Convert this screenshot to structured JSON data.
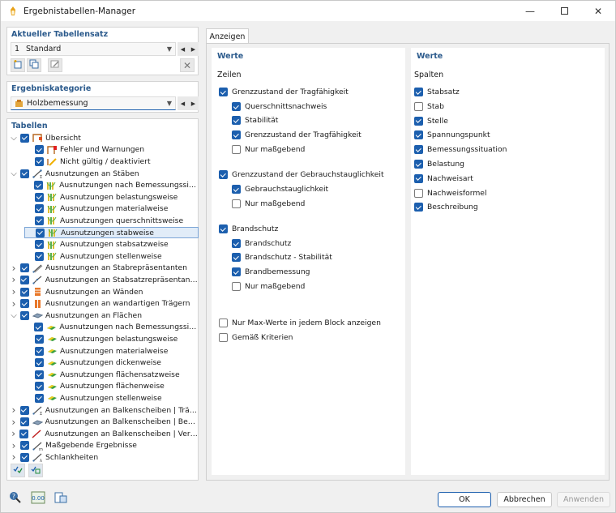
{
  "window": {
    "title": "Ergebnistabellen-Manager"
  },
  "tableset": {
    "header": "Aktueller Tabellensatz",
    "number": "1",
    "name": "Standard"
  },
  "category": {
    "header": "Ergebniskategorie",
    "value": "Holzbemessung"
  },
  "tables": {
    "header": "Tabellen",
    "items": [
      {
        "label": "Übersicht",
        "level": 0,
        "expander": "open",
        "checked": true,
        "icon": "overview-icon"
      },
      {
        "label": "Fehler und Warnungen",
        "level": 1,
        "expander": "",
        "checked": true,
        "icon": "error-icon"
      },
      {
        "label": "Nicht gültig / deaktiviert",
        "level": 1,
        "expander": "",
        "checked": true,
        "icon": "invalid-icon"
      },
      {
        "label": "Ausnutzungen an Stäben",
        "level": 0,
        "expander": "open",
        "checked": true,
        "icon": "member-icon"
      },
      {
        "label": "Ausnutzungen nach Bemessungssituati...",
        "level": 1,
        "expander": "",
        "checked": true,
        "icon": "ratio-icon"
      },
      {
        "label": "Ausnutzungen belastungsweise",
        "level": 1,
        "expander": "",
        "checked": true,
        "icon": "ratio-icon"
      },
      {
        "label": "Ausnutzungen materialweise",
        "level": 1,
        "expander": "",
        "checked": true,
        "icon": "ratio-icon"
      },
      {
        "label": "Ausnutzungen querschnittsweise",
        "level": 1,
        "expander": "",
        "checked": true,
        "icon": "ratio-icon"
      },
      {
        "label": "Ausnutzungen stabweise",
        "level": 1,
        "expander": "",
        "checked": true,
        "icon": "ratio-icon",
        "selected": true
      },
      {
        "label": "Ausnutzungen stabsatzweise",
        "level": 1,
        "expander": "",
        "checked": true,
        "icon": "ratio-icon"
      },
      {
        "label": "Ausnutzungen stellenweise",
        "level": 1,
        "expander": "",
        "checked": true,
        "icon": "ratio-icon"
      },
      {
        "label": "Ausnutzungen an Stabrepräsentanten",
        "level": 0,
        "expander": "closed",
        "checked": true,
        "icon": "member-rep-icon"
      },
      {
        "label": "Ausnutzungen an Stabsatzrepräsentanten",
        "level": 0,
        "expander": "closed",
        "checked": true,
        "icon": "memberset-rep-icon"
      },
      {
        "label": "Ausnutzungen an Wänden",
        "level": 0,
        "expander": "closed",
        "checked": true,
        "icon": "wall-icon"
      },
      {
        "label": "Ausnutzungen an wandartigen Trägern",
        "level": 0,
        "expander": "closed",
        "checked": true,
        "icon": "deep-beam-icon"
      },
      {
        "label": "Ausnutzungen an Flächen",
        "level": 0,
        "expander": "open",
        "checked": true,
        "icon": "surface-icon"
      },
      {
        "label": "Ausnutzungen nach Bemessungssitua...",
        "level": 1,
        "expander": "",
        "checked": true,
        "icon": "surface-ratio-icon"
      },
      {
        "label": "Ausnutzungen belastungsweise",
        "level": 1,
        "expander": "",
        "checked": true,
        "icon": "surface-ratio-icon"
      },
      {
        "label": "Ausnutzungen materialweise",
        "level": 1,
        "expander": "",
        "checked": true,
        "icon": "surface-ratio-icon"
      },
      {
        "label": "Ausnutzungen dickenweise",
        "level": 1,
        "expander": "",
        "checked": true,
        "icon": "surface-ratio-icon"
      },
      {
        "label": "Ausnutzungen flächensatzweise",
        "level": 1,
        "expander": "",
        "checked": true,
        "icon": "surface-ratio-icon"
      },
      {
        "label": "Ausnutzungen flächenweise",
        "level": 1,
        "expander": "",
        "checked": true,
        "icon": "surface-ratio-icon"
      },
      {
        "label": "Ausnutzungen stellenweise",
        "level": 1,
        "expander": "",
        "checked": true,
        "icon": "surface-ratio-icon"
      },
      {
        "label": "Ausnutzungen an Balkenscheiben | Träger",
        "level": 0,
        "expander": "closed",
        "checked": true,
        "icon": "shear-wall-beam-icon"
      },
      {
        "label": "Ausnutzungen an Balkenscheiben | Bepla...",
        "level": 0,
        "expander": "closed",
        "checked": true,
        "icon": "shear-wall-sheathing-icon"
      },
      {
        "label": "Ausnutzungen an Balkenscheiben | Verbin...",
        "level": 0,
        "expander": "closed",
        "checked": true,
        "icon": "shear-wall-connector-icon"
      },
      {
        "label": "Maßgebende Ergebnisse",
        "level": 0,
        "expander": "closed",
        "checked": true,
        "icon": "governing-icon"
      },
      {
        "label": "Schlankheiten",
        "level": 0,
        "expander": "closed",
        "checked": true,
        "icon": "slenderness-icon"
      }
    ]
  },
  "tab": {
    "label": "Anzeigen"
  },
  "values_left": {
    "title": "Werte",
    "rows_label": "Zeilen",
    "items": [
      {
        "label": "Grenzzustand der Tragfähigkeit",
        "checked": true,
        "indent": 0
      },
      {
        "label": "Querschnittsnachweis",
        "checked": true,
        "indent": 1
      },
      {
        "label": "Stabilität",
        "checked": true,
        "indent": 1
      },
      {
        "label": "Grenzzustand der Tragfähigkeit",
        "checked": true,
        "indent": 1
      },
      {
        "label": "Nur maßgebend",
        "checked": false,
        "indent": 1
      },
      {
        "label": "Grenzzustand der Gebrauchstauglichkeit",
        "checked": true,
        "indent": 0
      },
      {
        "label": "Gebrauchstauglichkeit",
        "checked": true,
        "indent": 1
      },
      {
        "label": "Nur maßgebend",
        "checked": false,
        "indent": 1
      },
      {
        "label": "Brandschutz",
        "checked": true,
        "indent": 0
      },
      {
        "label": "Brandschutz",
        "checked": true,
        "indent": 1
      },
      {
        "label": "Brandschutz - Stabilität",
        "checked": true,
        "indent": 1
      },
      {
        "label": "Brandbemessung",
        "checked": true,
        "indent": 1
      },
      {
        "label": "Nur maßgebend",
        "checked": false,
        "indent": 1
      },
      {
        "label": "Nur Max-Werte in jedem Block anzeigen",
        "checked": false,
        "indent": 0
      },
      {
        "label": "Gemäß Kriterien",
        "checked": false,
        "indent": 0
      }
    ]
  },
  "values_right": {
    "title": "Werte",
    "columns_label": "Spalten",
    "items": [
      {
        "label": "Stabsatz",
        "checked": true
      },
      {
        "label": "Stab",
        "checked": false
      },
      {
        "label": "Stelle",
        "checked": true
      },
      {
        "label": "Spannungspunkt",
        "checked": true
      },
      {
        "label": "Bemessungssituation",
        "checked": true
      },
      {
        "label": "Belastung",
        "checked": true
      },
      {
        "label": "Nachweisart",
        "checked": true
      },
      {
        "label": "Nachweisformel",
        "checked": false
      },
      {
        "label": "Beschreibung",
        "checked": true
      }
    ]
  },
  "buttons": {
    "ok": "OK",
    "cancel": "Abbrechen",
    "apply": "Anwenden"
  },
  "colors": {
    "accent": "#1c5fae",
    "header_text": "#2b5a8c",
    "selection": "#e1ecf8"
  }
}
